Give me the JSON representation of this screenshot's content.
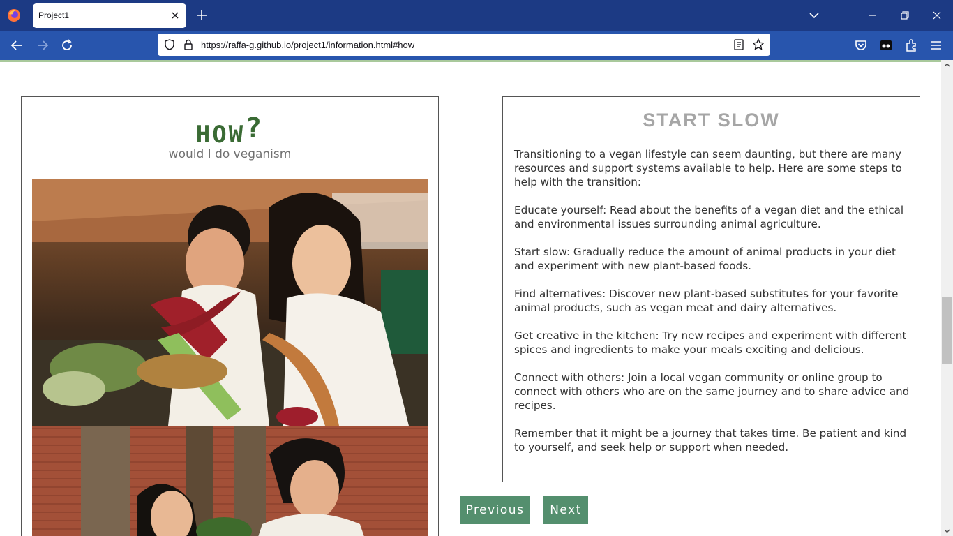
{
  "browser": {
    "tab_title": "Project1",
    "url": "https://raffa-g.github.io/project1/information.html#how"
  },
  "left_card": {
    "title_word": "HOW",
    "title_mark": "?",
    "subtitle": "would I do veganism"
  },
  "right_card": {
    "title": "START SLOW",
    "paragraphs": [
      "Transitioning to a vegan lifestyle can seem daunting, but there are many resources and support systems available to help. Here are some steps to help with the transition:",
      "Educate yourself: Read about the benefits of a vegan diet and the ethical and environmental issues surrounding animal agriculture.",
      "Start slow: Gradually reduce the amount of animal products in your diet and experiment with new plant-based foods.",
      "Find alternatives: Discover new plant-based substitutes for your favorite animal products, such as vegan meat and dairy alternatives.",
      "Get creative in the kitchen: Try new recipes and experiment with different spices and ingredients to make your meals exciting and delicious.",
      "Connect with others: Join a local vegan community or online group to connect with others who are on the same journey and to share advice and recipes.",
      "Remember that it might be a journey that takes time. Be patient and kind to yourself, and seek help or support when needed."
    ]
  },
  "nav_buttons": {
    "previous": "Previous",
    "next": "Next"
  },
  "colors": {
    "tab_bar": "#1c3a84",
    "nav_bar": "#2855ad",
    "title_green": "#3a6b34",
    "button_green": "#548f6e"
  },
  "icons": [
    "firefox-logo-icon",
    "close-icon",
    "plus-icon",
    "chevron-down-icon",
    "minimize-icon",
    "restore-icon",
    "back-arrow-icon",
    "forward-arrow-icon",
    "reload-icon",
    "shield-icon",
    "lock-icon",
    "reader-view-icon",
    "star-icon",
    "pocket-icon",
    "container-icon",
    "extensions-icon",
    "menu-icon"
  ]
}
